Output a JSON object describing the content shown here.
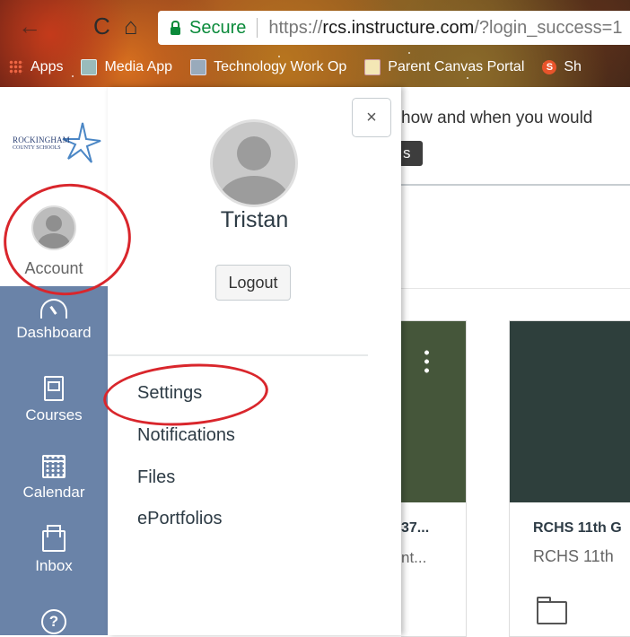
{
  "browser": {
    "secure_label": "Secure",
    "url_protocol": "https://",
    "url_domain": "rcs.instructure.com",
    "url_path": "/?login_success=1",
    "bookmarks": [
      "Apps",
      "Media App",
      "Technology Work Op",
      "Parent Canvas Portal",
      "Sh"
    ]
  },
  "global_nav": {
    "logo_text": [
      "ROCKINGHAM",
      "COUNTY SCHOOLS"
    ],
    "account_label": "Account",
    "items": [
      {
        "label": "Dashboard",
        "icon": "dashboard-icon"
      },
      {
        "label": "Courses",
        "icon": "courses-icon"
      },
      {
        "label": "Calendar",
        "icon": "calendar-icon"
      },
      {
        "label": "Inbox",
        "icon": "inbox-icon"
      },
      {
        "label": "",
        "icon": "help-icon"
      }
    ]
  },
  "account_tray": {
    "close_symbol": "×",
    "user_name": "Tristan",
    "logout_label": "Logout",
    "links": [
      "Settings",
      "Notifications",
      "Files",
      "ePortfolios"
    ]
  },
  "dashboard": {
    "notice_text": "how and when you would",
    "notice_button": "s",
    "cards": [
      {
        "title": "37...",
        "subtitle": "nt...",
        "color": "#45563a"
      },
      {
        "title": "RCHS 11th G",
        "subtitle": "RCHS 11th",
        "color": "#2e3f3c"
      }
    ]
  },
  "colors": {
    "nav_background": "#6a83a8",
    "annotation_red": "#d9262c",
    "secure_green": "#0a8a3a"
  }
}
